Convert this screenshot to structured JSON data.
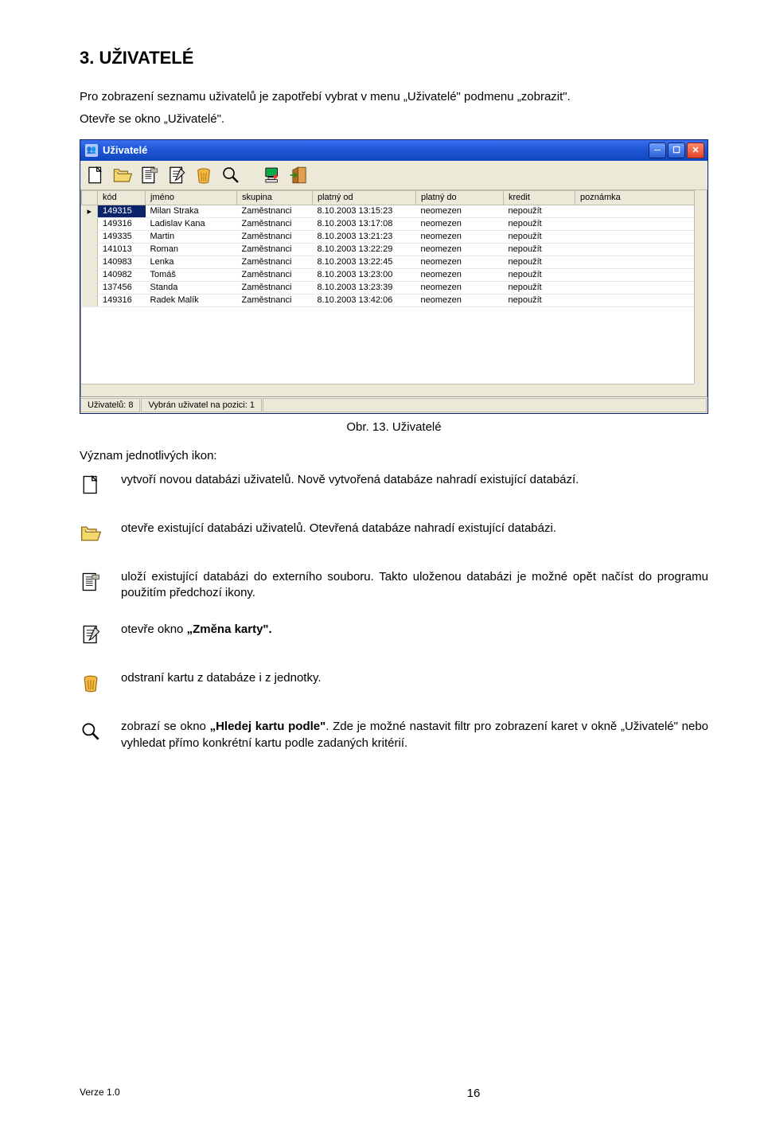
{
  "heading": "3.   UŽIVATELÉ",
  "intro_line1": "Pro  zobrazení  seznamu  uživatelů  je  zapotřebí  vybrat  v menu  „Uživatelé\"  podmenu    „zobrazit\".",
  "intro_line2": "Otevře se okno „Uživatelé\".",
  "window": {
    "title": "Uživatelé",
    "columns": [
      "kód",
      "jméno",
      "skupina",
      "platný od",
      "platný do",
      "kredit",
      "poznámka"
    ],
    "rows": [
      {
        "kod": "149315",
        "jmeno": "Milan Straka",
        "skupina": "Zaměstnanci",
        "od": "8.10.2003 13:15:23",
        "do": "neomezen",
        "kredit": "nepoužít",
        "pozn": ""
      },
      {
        "kod": "149316",
        "jmeno": "Ladislav Kana",
        "skupina": "Zaměstnanci",
        "od": "8.10.2003 13:17:08",
        "do": "neomezen",
        "kredit": "nepoužít",
        "pozn": ""
      },
      {
        "kod": "149335",
        "jmeno": "Martin",
        "skupina": "Zaměstnanci",
        "od": "8.10.2003 13:21:23",
        "do": "neomezen",
        "kredit": "nepoužít",
        "pozn": ""
      },
      {
        "kod": "141013",
        "jmeno": "Roman",
        "skupina": "Zaměstnanci",
        "od": "8.10.2003 13:22:29",
        "do": "neomezen",
        "kredit": "nepoužít",
        "pozn": ""
      },
      {
        "kod": "140983",
        "jmeno": "Lenka",
        "skupina": "Zaměstnanci",
        "od": "8.10.2003 13:22:45",
        "do": "neomezen",
        "kredit": "nepoužít",
        "pozn": ""
      },
      {
        "kod": "140982",
        "jmeno": "Tomáš",
        "skupina": "Zaměstnanci",
        "od": "8.10.2003 13:23:00",
        "do": "neomezen",
        "kredit": "nepoužít",
        "pozn": ""
      },
      {
        "kod": "137456",
        "jmeno": "Standa",
        "skupina": "Zaměstnanci",
        "od": "8.10.2003 13:23:39",
        "do": "neomezen",
        "kredit": "nepoužít",
        "pozn": ""
      },
      {
        "kod": "149316",
        "jmeno": "Radek Malík",
        "skupina": "Zaměstnanci",
        "od": "8.10.2003 13:42:06",
        "do": "neomezen",
        "kredit": "nepoužít",
        "pozn": ""
      }
    ],
    "status_left": "Uživatelů: 8",
    "status_right": "Vybrán uživatel na pozici: 1"
  },
  "caption": "Obr. 13. Uživatelé",
  "icons_intro": "Význam jednotlivých ikon:",
  "descriptions": {
    "new": "vytvoří novou databázi uživatelů. Nově vytvořená databáze nahradí existující databází.",
    "open": "otevře existující databázi uživatelů. Otevřená databáze nahradí existující databázi.",
    "save": "uloží existující databázi do externího souboru.  Takto uloženou databázi je možné opět načíst do programu použitím předchozí ikony.",
    "edit_pre": "otevře okno ",
    "edit_bold": "„Změna karty\".",
    "delete": "odstraní kartu z databáze i z jednotky.",
    "search_pre": "zobrazí se okno ",
    "search_bold": "„Hledej kartu podle\"",
    "search_post": ". Zde je možné nastavit filtr pro zobrazení karet v okně „Uživatelé\" nebo vyhledat přímo konkrétní kartu  podle zadaných kritérií."
  },
  "footer": {
    "version": "Verze 1.0",
    "page": "16"
  }
}
